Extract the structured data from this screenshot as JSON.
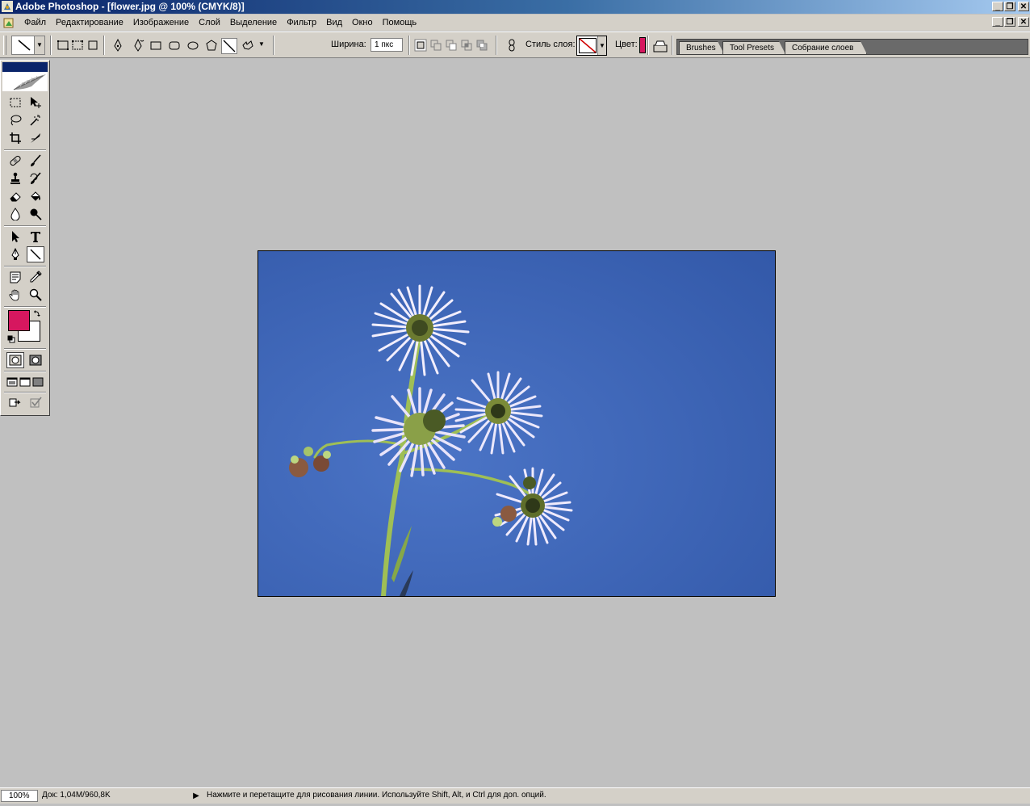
{
  "window": {
    "title": "Adobe Photoshop - [flower.jpg @ 100% (CMYK/8)]",
    "minimize_glyph": "_",
    "restore_glyph": "❐",
    "close_glyph": "✕"
  },
  "menubar": {
    "items": [
      "Файл",
      "Редактирование",
      "Изображение",
      "Слой",
      "Выделение",
      "Фильтр",
      "Вид",
      "Окно",
      "Помощь"
    ]
  },
  "options": {
    "width_label": "Ширина:",
    "width_value": "1 пкс",
    "layer_style_label": "Стиль слоя:",
    "color_label": "Цвет:",
    "color": "#d6175f"
  },
  "palette_well": {
    "tabs": [
      "Brushes",
      "Tool Presets",
      "Собрание слоев"
    ]
  },
  "toolbox": {
    "foreground_color": "#d6175f",
    "background_color": "#ffffff",
    "selected_tool": "line-tool"
  },
  "document": {
    "file": "flower.jpg",
    "sky_color": "#3a62b0"
  },
  "statusbar": {
    "zoom": "100%",
    "doc_size": "Док: 1,04M/960,8K",
    "hint": "Нажмите и перетащите для рисования линии. Используйте Shift, Alt, и Ctrl для доп. опций."
  }
}
